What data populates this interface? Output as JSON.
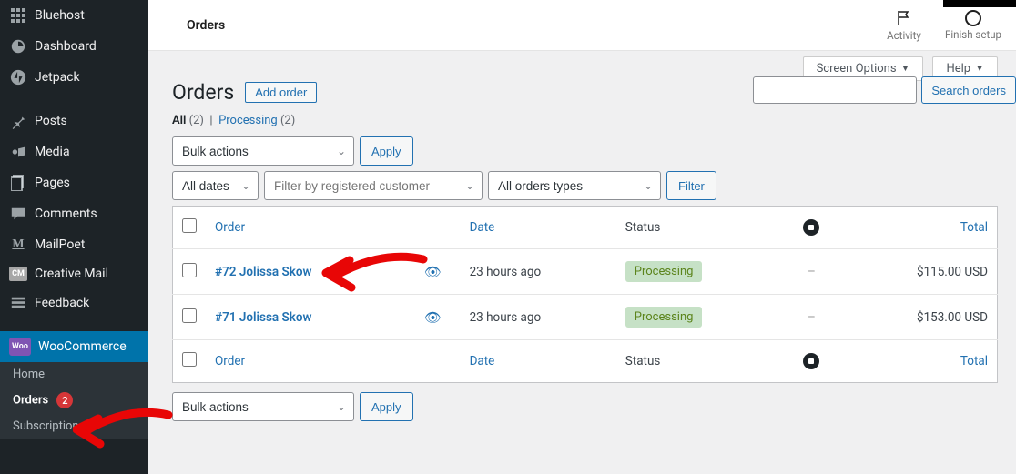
{
  "sidebar": {
    "items": [
      {
        "label": "Bluehost"
      },
      {
        "label": "Dashboard"
      },
      {
        "label": "Jetpack"
      },
      {
        "label": "Posts"
      },
      {
        "label": "Media"
      },
      {
        "label": "Pages"
      },
      {
        "label": "Comments"
      },
      {
        "label": "MailPoet"
      },
      {
        "label": "Creative Mail"
      },
      {
        "label": "Feedback"
      },
      {
        "label": "WooCommerce"
      }
    ],
    "woo_badge": "Woo",
    "cm_badge": "CM",
    "submenu": [
      {
        "label": "Home"
      },
      {
        "label": "Orders",
        "badge": "2"
      },
      {
        "label": "Subscriptions"
      }
    ]
  },
  "topbar": {
    "title": "Orders",
    "activity": "Activity",
    "finish": "Finish setup"
  },
  "tabs": {
    "screen_options": "Screen Options",
    "help": "Help"
  },
  "page": {
    "heading": "Orders",
    "add_order": "Add order",
    "views_all": "All",
    "views_all_count": "(2)",
    "views_pipe": "|",
    "views_processing": "Processing",
    "views_processing_count": "(2)",
    "search_btn": "Search orders",
    "bulk_actions": "Bulk actions",
    "apply": "Apply",
    "all_dates": "All dates",
    "filter_placeholder": "Filter by registered customer",
    "all_order_types": "All orders types",
    "filter": "Filter"
  },
  "table": {
    "cols": {
      "order": "Order",
      "date": "Date",
      "status": "Status",
      "total": "Total"
    },
    "rows": [
      {
        "order": "#72 Jolissa Skow",
        "date": "23 hours ago",
        "status": "Processing",
        "origin": "–",
        "total": "$115.00 USD"
      },
      {
        "order": "#71 Jolissa Skow",
        "date": "23 hours ago",
        "status": "Processing",
        "origin": "–",
        "total": "$153.00 USD"
      }
    ]
  }
}
